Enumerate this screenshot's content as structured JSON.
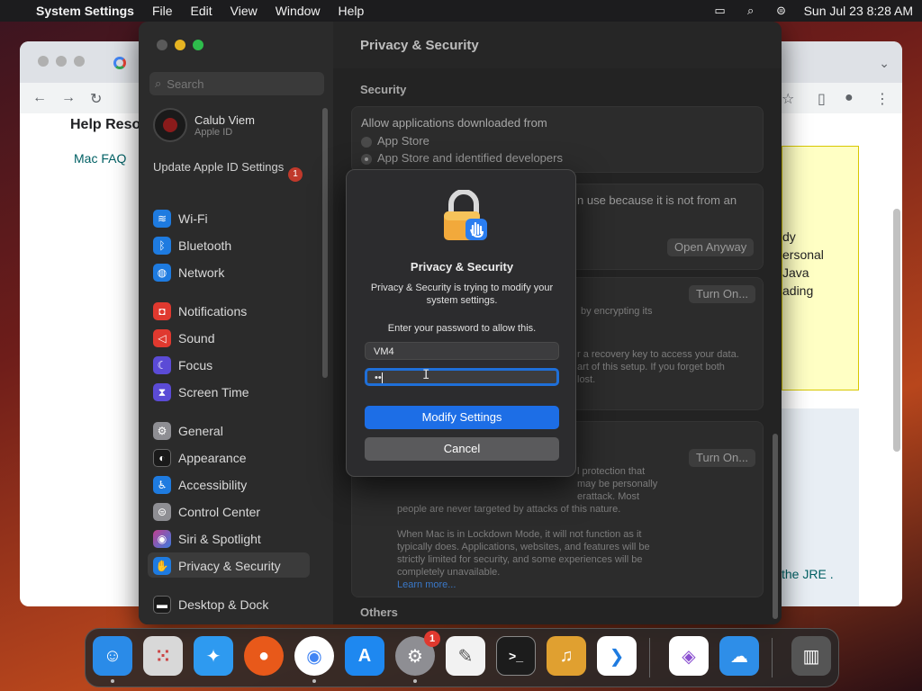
{
  "menubar": {
    "app_name": "System Settings",
    "menus": [
      "File",
      "Edit",
      "View",
      "Window",
      "Help"
    ],
    "datetime": "Sun Jul 23  8:28 AM"
  },
  "browser": {
    "heading": "Help Reso",
    "link": "Mac FAQ",
    "yellow_lines": [
      "dy",
      "ersonal",
      "Java",
      "ading"
    ],
    "jre_link": "the JRE ."
  },
  "settings": {
    "title": "Privacy & Security",
    "search_placeholder": "Search",
    "user": {
      "name": "Calub Viem",
      "sub": "Apple ID"
    },
    "update": {
      "label": "Update Apple ID Settings",
      "badge": "1"
    },
    "sidebar": [
      {
        "label": "Wi-Fi",
        "icon": "wifi-icon",
        "color": "#1e7be0"
      },
      {
        "label": "Bluetooth",
        "icon": "bluetooth-icon",
        "color": "#1e7be0"
      },
      {
        "label": "Network",
        "icon": "globe-icon",
        "color": "#1e7be0"
      },
      {
        "label": "Notifications",
        "icon": "bell-icon",
        "color": "#e0392f"
      },
      {
        "label": "Sound",
        "icon": "speaker-icon",
        "color": "#e0392f"
      },
      {
        "label": "Focus",
        "icon": "moon-icon",
        "color": "#5b4bd6"
      },
      {
        "label": "Screen Time",
        "icon": "hourglass-icon",
        "color": "#5b4bd6"
      },
      {
        "label": "General",
        "icon": "gear-icon",
        "color": "#8e8e93"
      },
      {
        "label": "Appearance",
        "icon": "appearance-icon",
        "color": "#2c2c2c"
      },
      {
        "label": "Accessibility",
        "icon": "accessibility-icon",
        "color": "#1e7be0"
      },
      {
        "label": "Control Center",
        "icon": "control-center-icon",
        "color": "#8e8e93"
      },
      {
        "label": "Siri & Spotlight",
        "icon": "siri-icon",
        "color": "#c2408f"
      },
      {
        "label": "Privacy & Security",
        "icon": "hand-icon",
        "color": "#1e7be0"
      },
      {
        "label": "Desktop & Dock",
        "icon": "dock-icon",
        "color": "#2c2c2c"
      }
    ],
    "security_label": "Security",
    "allow_label": "Allow applications downloaded from",
    "opt_app_store": "App Store",
    "opt_identified": "App Store and identified developers",
    "blocked_text": "n use because it is not from an",
    "open_anyway": "Open Anyway",
    "turn_on_1": "Turn On...",
    "filevault_text": "by encrypting its",
    "recovery_lines": [
      "r a recovery key to access your data.",
      "art of this setup. If you forget both",
      "lost."
    ],
    "turn_on_2": "Turn On...",
    "lockdown_lines": [
      "l protection that",
      "may be personally",
      "erattack. Most",
      "people are never targeted by attacks of this nature."
    ],
    "lockdown_desc": [
      "When Mac is in Lockdown Mode, it will not function as it",
      "typically does. Applications, websites, and features will be",
      "strictly limited for security, and some experiences will be",
      "completely unavailable."
    ],
    "learn_more": "Learn more...",
    "others_label": "Others"
  },
  "dialog": {
    "title": "Privacy & Security",
    "message": "Privacy & Security is trying to modify your system settings.",
    "prompt": "Enter your password to allow this.",
    "username": "VM4",
    "password_mask": "••",
    "primary": "Modify Settings",
    "cancel": "Cancel"
  },
  "dock": [
    {
      "name": "finder",
      "glyph": "☺",
      "color": "#2a8be8"
    },
    {
      "name": "launchpad",
      "glyph": "⁙",
      "color": "#d8d8d8"
    },
    {
      "name": "safari",
      "glyph": "✦",
      "color": "#2e9af0"
    },
    {
      "name": "firefox",
      "glyph": "●",
      "color": "#e8591a"
    },
    {
      "name": "chrome",
      "glyph": "◉",
      "color": "#ffffff"
    },
    {
      "name": "app-store",
      "glyph": "A",
      "color": "#1e88f0"
    },
    {
      "name": "system-settings",
      "glyph": "⚙",
      "color": "#8e8e93",
      "badge": "1"
    },
    {
      "name": "textedit",
      "glyph": "✎",
      "color": "#f2f2f2"
    },
    {
      "name": "terminal",
      "glyph": ">_",
      "color": "#1c1c1c"
    },
    {
      "name": "garageband",
      "glyph": "♫",
      "color": "#e0a030"
    },
    {
      "name": "vscode",
      "glyph": "❯",
      "color": "#ffffff"
    },
    {
      "name": "visual-studio",
      "glyph": "◈",
      "color": "#ffffff"
    },
    {
      "name": "weather",
      "glyph": "☁",
      "color": "#2e8ee8"
    },
    {
      "name": "trash",
      "glyph": "🗑",
      "color": "#444444"
    }
  ]
}
